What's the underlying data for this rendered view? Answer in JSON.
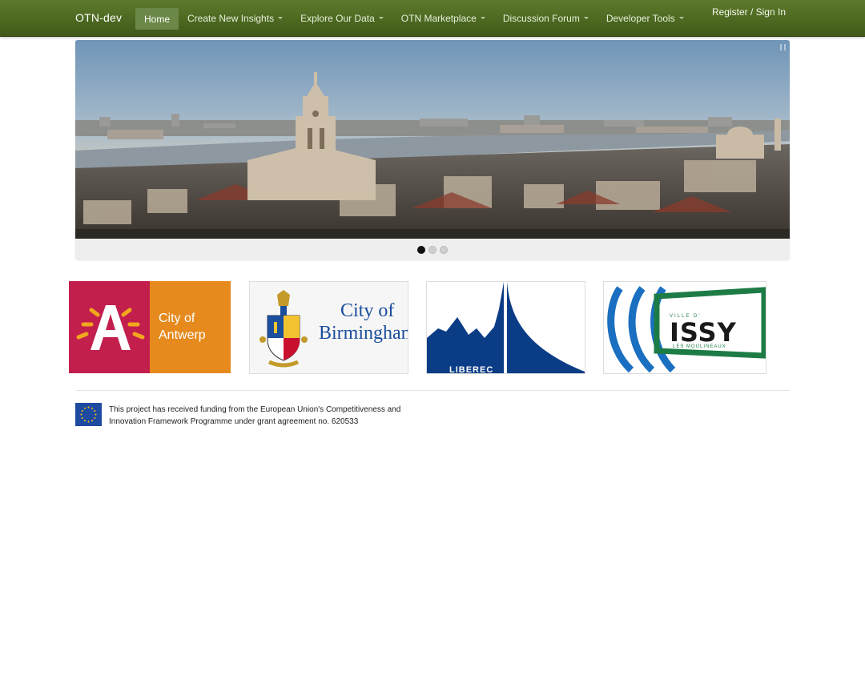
{
  "navbar": {
    "brand": "OTN-dev",
    "items": [
      {
        "label": "Home",
        "active": true,
        "dropdown": false
      },
      {
        "label": "Create New Insights",
        "active": false,
        "dropdown": true
      },
      {
        "label": "Explore Our Data",
        "active": false,
        "dropdown": true
      },
      {
        "label": "OTN Marketplace",
        "active": false,
        "dropdown": true
      },
      {
        "label": "Discussion Forum",
        "active": false,
        "dropdown": true
      },
      {
        "label": "Developer Tools",
        "active": false,
        "dropdown": true
      }
    ],
    "register_label": "Register / Sign In"
  },
  "carousel": {
    "slide_count": 3,
    "active_index": 0
  },
  "partners": {
    "antwerp": {
      "name_line1": "City of",
      "name_line2": "Antwerp"
    },
    "birmingham": {
      "name_line1": "City of",
      "name_line2": "Birmingham"
    },
    "liberec": {
      "name": "LIBEREC"
    },
    "issy": {
      "name": "ISSY",
      "top_text": "VILLE D'",
      "bottom_text": "LES MOULINEAUX"
    }
  },
  "footer": {
    "funding_line1": "This project has received funding from the European Union's Competitiveness and",
    "funding_line2": "Innovation Framework Programme under grant agreement no. 620533"
  },
  "colors": {
    "navbar": "#4f6b22",
    "antwerp_red": "#c31f4d",
    "antwerp_orange": "#e68a1e",
    "birmingham_blue": "#1b4e9c",
    "liberec_blue": "#0b3c86",
    "issy_green": "#1d7c45",
    "issy_blue": "#1a6fc0",
    "eu_blue": "#1f4aa1",
    "eu_gold": "#ffcc00"
  }
}
